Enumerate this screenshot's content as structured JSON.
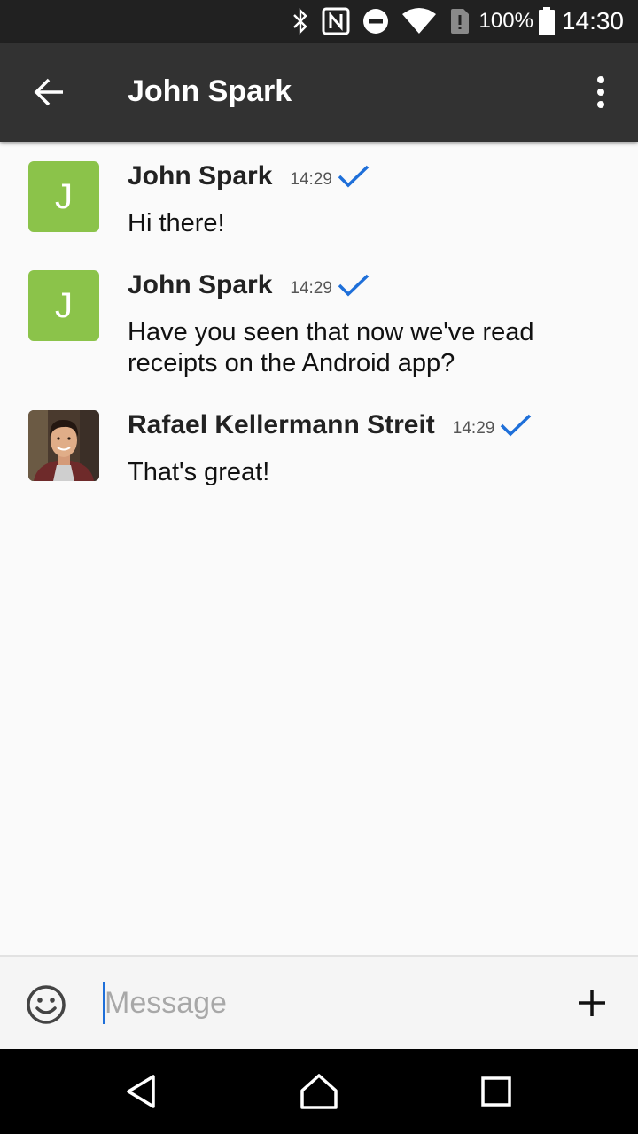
{
  "status_bar": {
    "icons": [
      "bluetooth-icon",
      "nfc-icon",
      "do-not-disturb-icon",
      "wifi-icon",
      "sim-alert-icon",
      "battery-icon"
    ],
    "battery": "100%",
    "time": "14:30"
  },
  "app_bar": {
    "title": "John Spark",
    "back_icon": "arrow-left-icon",
    "menu_icon": "more-vert-icon"
  },
  "messages": [
    {
      "sender": "John Spark",
      "initial": "J",
      "time": "14:29",
      "text": "Hi there!",
      "status_icon": "read-check-icon"
    },
    {
      "sender": "John Spark",
      "initial": "J",
      "time": "14:29",
      "text": "Have you seen that now we've read receipts on the Android app?",
      "status_icon": "read-check-icon"
    },
    {
      "sender": "Rafael Kellermann Streit",
      "time": "14:29",
      "text": "That's great!",
      "status_icon": "read-check-icon"
    }
  ],
  "composer": {
    "placeholder": "Message",
    "value": ""
  },
  "nav_bar": {
    "icons": [
      "back-triangle-icon",
      "home-icon",
      "recents-icon"
    ]
  },
  "colors": {
    "status_bar_bg": "#212121",
    "app_bar_bg": "#323232",
    "avatar_green": "#8bc34a",
    "check_blue": "#1e6fd9"
  }
}
